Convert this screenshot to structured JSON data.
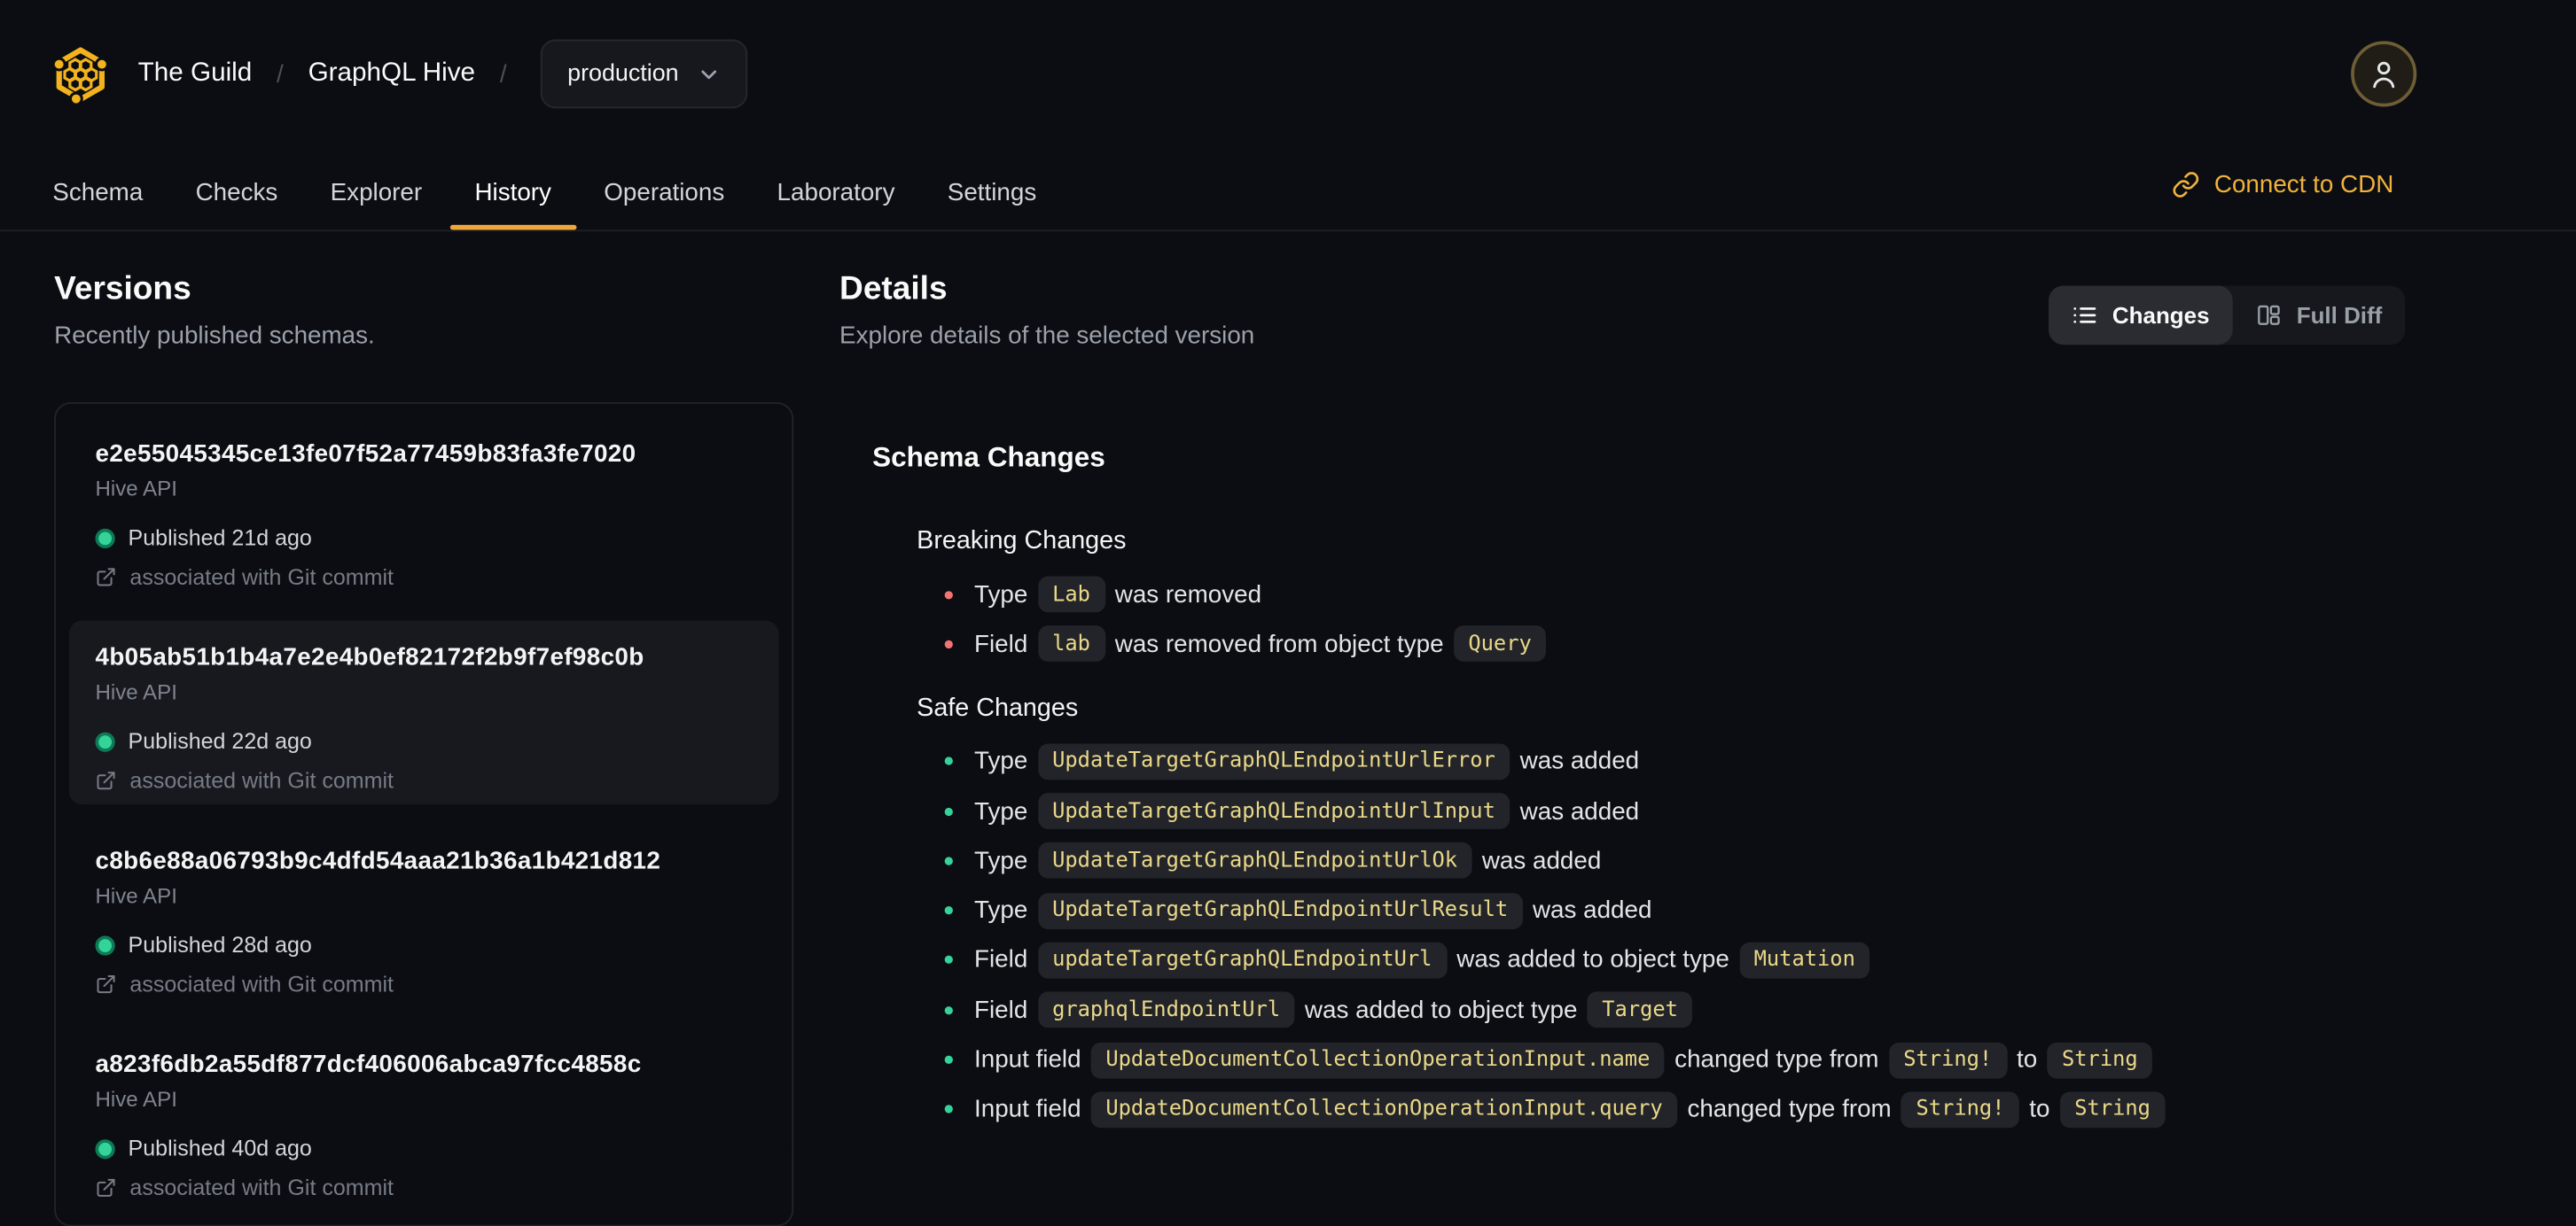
{
  "theme": {
    "page_bg": "#0b0d12",
    "brand_yellow": "#f2b31c",
    "accent_tab_underline": "#f0a63a",
    "cdn_link_color": "#f0b23c",
    "breaking_dot": "#f37272",
    "safe_dot": "#34d399",
    "published_dot": "#34d399",
    "chip_text": "#ead889",
    "chip_bg": "#222429",
    "selected_item_bg": "#17191f"
  },
  "header": {
    "logo": "hive-logo",
    "breadcrumb": {
      "org": "The Guild",
      "separator": "/",
      "project": "GraphQL Hive",
      "target": "production",
      "target_chevron": "chevron-down-icon"
    },
    "tabs": [
      "Schema",
      "Checks",
      "Explorer",
      "History",
      "Operations",
      "Laboratory",
      "Settings"
    ],
    "active_tab": "History",
    "cdn_label": "Connect to CDN",
    "avatar_icon": "user-icon"
  },
  "versions": {
    "title": "Versions",
    "subtitle": "Recently published schemas.",
    "items": [
      {
        "hash": "e2e55045345ce13fe07f52a77459b83fa3fe7020",
        "service": "Hive API",
        "published": "Published 21d ago",
        "git": "associated with Git commit",
        "selected": false
      },
      {
        "hash": "4b05ab51b1b4a7e2e4b0ef82172f2b9f7ef98c0b",
        "service": "Hive API",
        "published": "Published 22d ago",
        "git": "associated with Git commit",
        "selected": true
      },
      {
        "hash": "c8b6e88a06793b9c4dfd54aaa21b36a1b421d812",
        "service": "Hive API",
        "published": "Published 28d ago",
        "git": "associated with Git commit",
        "selected": false
      },
      {
        "hash": "a823f6db2a55df877dcf406006abca97fcc4858c",
        "service": "Hive API",
        "published": "Published 40d ago",
        "git": "associated with Git commit",
        "selected": false
      }
    ]
  },
  "details": {
    "title": "Details",
    "subtitle": "Explore details of the selected version",
    "view_toggle": [
      {
        "label": "Changes",
        "icon": "list-icon",
        "active": true
      },
      {
        "label": "Full Diff",
        "icon": "columns-icon",
        "active": false
      }
    ],
    "schema_changes_title": "Schema Changes",
    "sections": [
      {
        "title": "Breaking Changes",
        "kind": "breaking",
        "items": [
          [
            "Type",
            {
              "code": "Lab"
            },
            "was removed"
          ],
          [
            "Field",
            {
              "code": "lab"
            },
            "was removed from object type",
            {
              "code": "Query"
            }
          ]
        ]
      },
      {
        "title": "Safe Changes",
        "kind": "safe",
        "items": [
          [
            "Type",
            {
              "code": "UpdateTargetGraphQLEndpointUrlError"
            },
            "was added"
          ],
          [
            "Type",
            {
              "code": "UpdateTargetGraphQLEndpointUrlInput"
            },
            "was added"
          ],
          [
            "Type",
            {
              "code": "UpdateTargetGraphQLEndpointUrlOk"
            },
            "was added"
          ],
          [
            "Type",
            {
              "code": "UpdateTargetGraphQLEndpointUrlResult"
            },
            "was added"
          ],
          [
            "Field",
            {
              "code": "updateTargetGraphQLEndpointUrl"
            },
            "was added to object type",
            {
              "code": "Mutation"
            }
          ],
          [
            "Field",
            {
              "code": "graphqlEndpointUrl"
            },
            "was added to object type",
            {
              "code": "Target"
            }
          ],
          [
            "Input field",
            {
              "code": "UpdateDocumentCollectionOperationInput.name"
            },
            "changed type from",
            {
              "code": "String!"
            },
            "to",
            {
              "code": "String"
            }
          ],
          [
            "Input field",
            {
              "code": "UpdateDocumentCollectionOperationInput.query"
            },
            "changed type from",
            {
              "code": "String!"
            },
            "to",
            {
              "code": "String"
            }
          ]
        ]
      }
    ]
  }
}
